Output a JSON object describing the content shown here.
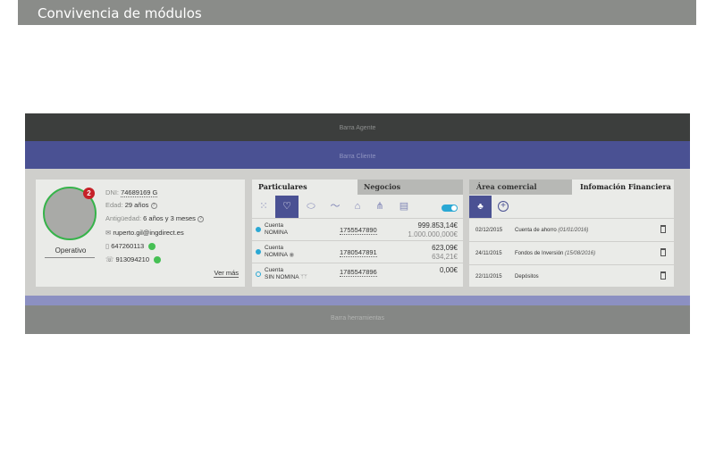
{
  "page": {
    "title": "Convivencia de módulos"
  },
  "bars": {
    "agente": "Barra Agente",
    "cliente": "Barra Cliente",
    "herramientas": "Barra herramientas"
  },
  "profile": {
    "badge_count": "2",
    "status": "Operativo",
    "dni_label": "DNI:",
    "dni_value": "74689169 G",
    "edad_label": "Edad:",
    "edad_value": "29 años",
    "antiguedad_label": "Antigüedad:",
    "antiguedad_value": "6 años y 3 meses",
    "email": "ruperto.gil@ingdirect.es",
    "mobile": "647260113",
    "phone": "913094210",
    "ver_mas": "Ver más"
  },
  "products": {
    "tabs": [
      "Particulares",
      "Negocios"
    ],
    "icons": [
      "grid-icon",
      "heart-icon",
      "piggy-bank-icon",
      "trend-icon",
      "house-icon",
      "people-icon",
      "cards-icon"
    ],
    "toggle_on": true,
    "rows": [
      {
        "type_line1": "Cuenta",
        "type_line2": "NOMINA",
        "number": "1755547890",
        "amount": "999.853,14€",
        "amount_sub": "1.000.000,000€",
        "filled": true
      },
      {
        "type_line1": "Cuenta",
        "type_line2": "NOMINA",
        "number": "1780547891",
        "amount": "623,09€",
        "amount_sub": "634,21€",
        "filled": true
      },
      {
        "type_line1": "Cuenta",
        "type_line2": "SIN NOMINA",
        "number": "1785547896",
        "amount": "0,00€",
        "amount_sub": "",
        "filled": false
      }
    ]
  },
  "finance": {
    "tabs": [
      "Área comercial",
      "Infomación Financiera"
    ],
    "rows": [
      {
        "date": "02/12/2015",
        "desc": "Cuenta de ahorro",
        "desc_date": "(01/01/2016)"
      },
      {
        "date": "24/11/2015",
        "desc": "Fondos de Inversión",
        "desc_date": "(15/08/2016)"
      },
      {
        "date": "22/11/2015",
        "desc": "Depósitos",
        "desc_date": ""
      }
    ]
  },
  "colors": {
    "accent": "#4a5193",
    "status_green": "#36b34a",
    "badge_red": "#c62229",
    "toggle_blue": "#2aa8d4"
  }
}
